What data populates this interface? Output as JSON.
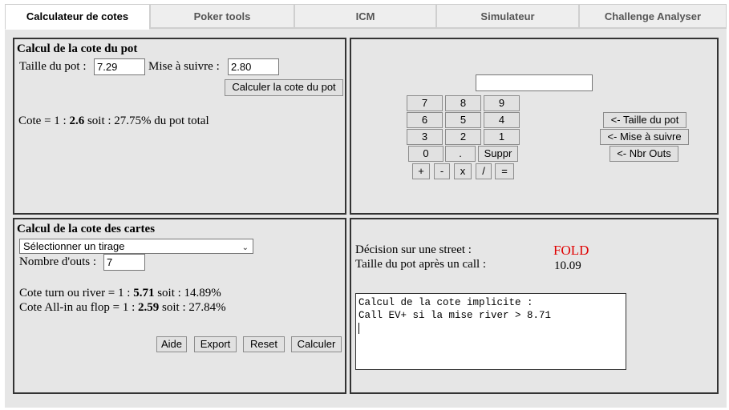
{
  "tabs": [
    {
      "label": "Calculateur de cotes"
    },
    {
      "label": "Poker tools"
    },
    {
      "label": "ICM"
    },
    {
      "label": "Simulateur"
    },
    {
      "label": "Challenge Analyser"
    }
  ],
  "pot_odds": {
    "title": "Calcul de la cote du pot",
    "pot_label": "Taille du pot :",
    "pot_value": "7.29",
    "bet_label": "Mise à suivre :",
    "bet_value": "2.80",
    "calc_button": "Calculer la cote du pot",
    "result_prefix": "Cote = 1 : ",
    "result_ratio": "2.6",
    "result_suffix": " soit : 27.75% du pot total"
  },
  "keypad": {
    "display_value": "",
    "keys": [
      "7",
      "8",
      "9",
      "6",
      "5",
      "4",
      "3",
      "2",
      "1",
      "0",
      ".",
      "Suppr"
    ],
    "ops": [
      "+",
      "-",
      "x",
      "/",
      "="
    ],
    "side_buttons": [
      "<- Taille du pot",
      "<- Mise à suivre",
      "<- Nbr Outs"
    ]
  },
  "card_odds": {
    "title": "Calcul de la cote des cartes",
    "select_value": "Sélectionner un tirage",
    "outs_label": "Nombre d'outs :",
    "outs_value": "7",
    "turn_prefix": "Cote turn ou river = 1 : ",
    "turn_ratio": "5.71",
    "turn_suffix": " soit : 14.89%",
    "allin_prefix": "Cote All-in au flop = 1 : ",
    "allin_ratio": "2.59",
    "allin_suffix": " soit : 27.84%",
    "buttons": [
      "Aide",
      "Export",
      "Reset",
      "Calculer"
    ]
  },
  "decision": {
    "street_label": "Décision sur une street :",
    "street_value": "FOLD",
    "pot_after_label": "Taille du pot après un call :",
    "pot_after_value": "10.09",
    "implied_line1": "Calcul de la cote implicite :",
    "implied_line2": "Call EV+ si la mise river > 8.71",
    "fold_color": "#e00000"
  }
}
